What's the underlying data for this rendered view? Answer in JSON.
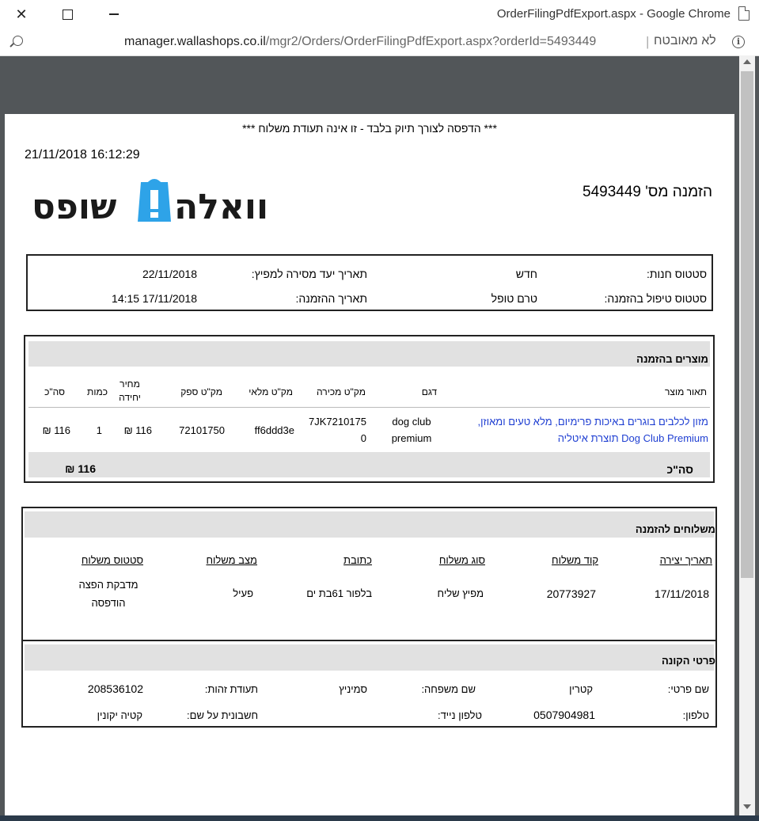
{
  "window": {
    "title": "OrderFilingPdfExport.aspx - Google Chrome",
    "url_host": "manager.wallashops.co.il",
    "url_path": "/mgr2/Orders/OrderFilingPdfExport.aspx?orderId=5493449",
    "not_secure": "לא מאובטח"
  },
  "doc": {
    "notice": "*** הדפסה לצורך תיוק בלבד - זו אינה תעודת משלוח ***",
    "print_datetime": "21/11/2018 16:12:29",
    "order_title": "הזמנה מס' 5493449",
    "logo_text": "וואלה!שופס"
  },
  "status": {
    "store_status_label": "סטטוס חנות:",
    "store_status_value": "חדש",
    "delivery_date_label": "תאריך יעד מסירה למפיץ:",
    "delivery_date_value": "22/11/2018",
    "handling_status_label": "סטטוס טיפול בהזמנה:",
    "handling_status_value": "טרם טופל",
    "order_date_label": "תאריך ההזמנה:",
    "order_date_value": "17/11/2018 14:15"
  },
  "products": {
    "header": "מוצרים בהזמנה",
    "columns": {
      "description": "תאור מוצר",
      "model": "דגם",
      "sale_sku": "מק\"ט מכירה",
      "stock_sku": "מק\"ט מלאי",
      "supplier_sku": "מק\"ט ספק",
      "unit_price_1": "מחיר",
      "unit_price_2": "יחידה",
      "quantity": "כמות",
      "total": "סה\"כ"
    },
    "row": {
      "description_1": "מזון לכלבים בוגרים באיכות פרימיום, מלא טעים ומאוזן,",
      "description_2": "Dog Club Premium תוצרת איטליה",
      "model_1": "dog club",
      "model_2": "premium",
      "sale_sku_1": "7JK7210175",
      "sale_sku_2": "0",
      "stock_sku": "ff6ddd3e",
      "supplier_sku": "72101750",
      "unit_price": "116 ₪",
      "quantity": "1",
      "total": "116 ₪"
    },
    "footer_label": "סה\"כ",
    "footer_total": "116 ₪"
  },
  "shipments": {
    "header": "משלוחים להזמנה",
    "columns": {
      "created": "תאריך יצירה",
      "code": "קוד משלוח",
      "type": "סוג משלוח",
      "address": "כתובת",
      "state": "מצב משלוח",
      "status": "סטטוס משלוח"
    },
    "row": {
      "created": "17/11/2018",
      "code": "20773927",
      "type": "מפיץ שליח",
      "address": "בלפור 61בת ים",
      "state": "פעיל",
      "status_1": "מדבקת הפצה",
      "status_2": "הודפסה"
    }
  },
  "buyer": {
    "header": "פרטי הקונה",
    "first_name_label": "שם פרטי:",
    "first_name": "קטרין",
    "last_name_label": "שם משפחה:",
    "last_name": "סמיניץ",
    "id_label": "תעודת זהות:",
    "id_value": "208536102",
    "phone_label": "טלפון:",
    "phone": "0507904981",
    "mobile_label": "טלפון נייד:",
    "mobile": "",
    "invoice_name_label": "חשבונית על שם:",
    "invoice_name": "קטיה יקונין"
  }
}
